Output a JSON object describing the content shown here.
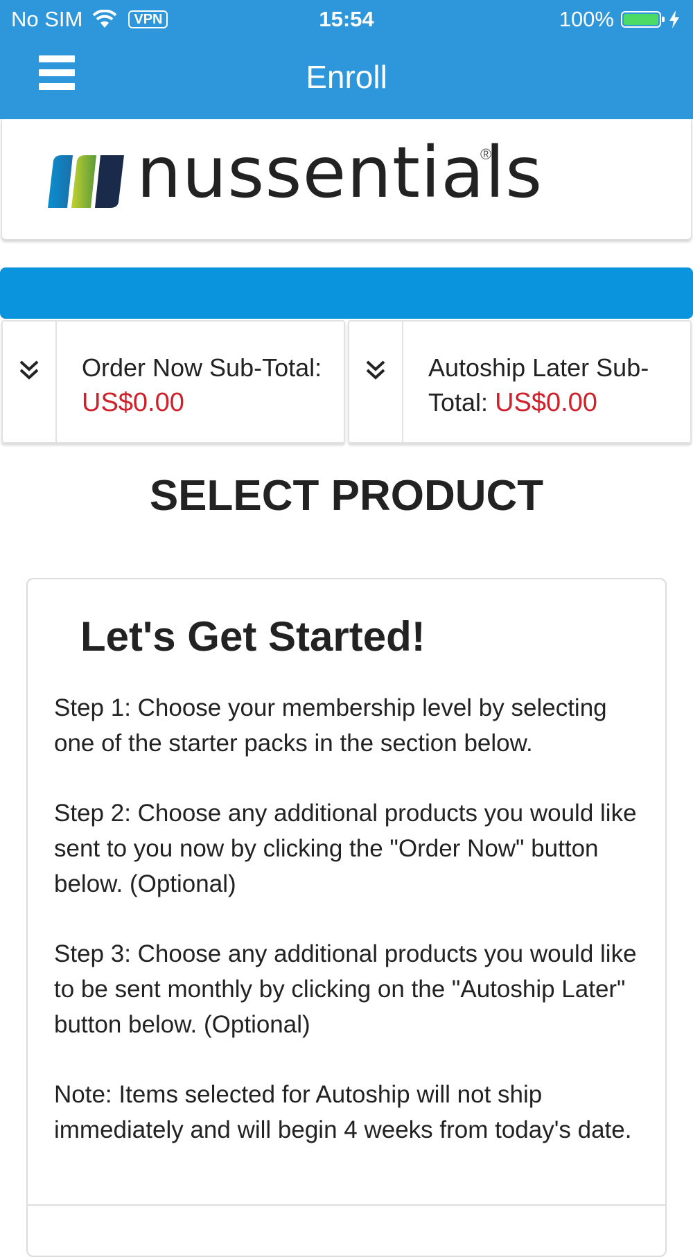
{
  "status_bar": {
    "carrier": "No SIM",
    "vpn": "VPN",
    "time": "15:54",
    "battery": "100%",
    "battery_level": 1.0
  },
  "nav": {
    "title": "Enroll",
    "menu_icon": "hamburger-menu-icon"
  },
  "logo": {
    "brand": "nussentials",
    "registered": "®"
  },
  "subtotals": {
    "order_now": {
      "label": "Order Now Sub-Total:",
      "amount": "US$0.00",
      "icon": "double-chevron-down-icon"
    },
    "autoship_later": {
      "label": "Autoship Later Sub-Total:",
      "amount": "US$0.00",
      "icon": "double-chevron-down-icon"
    }
  },
  "section_title": "SELECT PRODUCT",
  "card": {
    "title": "Let's Get Started!",
    "steps": [
      "Step 1: Choose your membership level by selecting one of the starter packs in the section below.",
      "Step 2: Choose any additional products you would like sent to you now by clicking the \"Order Now\" button below. (Optional)",
      "Step 3: Choose any additional products you would like to be sent monthly by clicking on the \"Autoship Later\" button below. (Optional)",
      "Note: Items selected for Autoship will not ship immediately and will begin 4 weeks from today's date."
    ]
  },
  "colors": {
    "header": "#2e97dc",
    "accent_bar": "#0a94dd",
    "amount": "#d0202a"
  }
}
